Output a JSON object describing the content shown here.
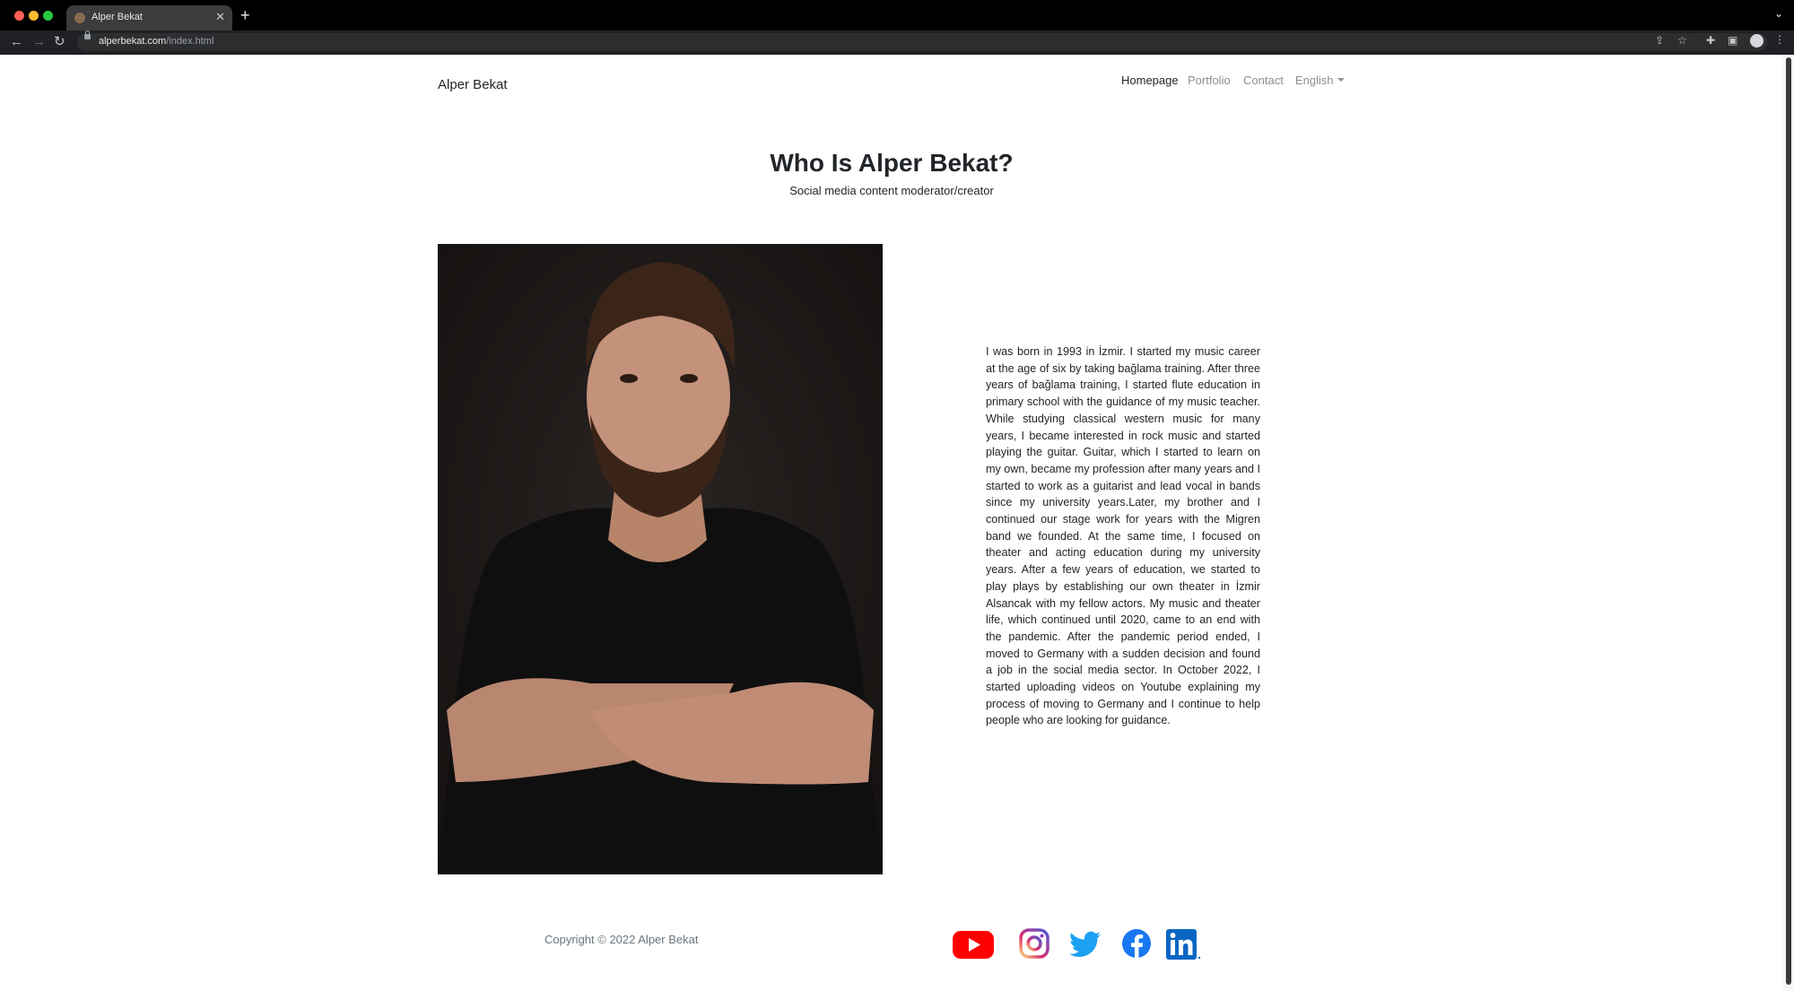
{
  "browser": {
    "tab_title": "Alper Bekat",
    "url_host": "alperbekat.com",
    "url_path": "/index.html"
  },
  "site": {
    "brand": "Alper Bekat",
    "nav": [
      {
        "label": "Homepage",
        "active": true
      },
      {
        "label": "Portfolio",
        "active": false
      },
      {
        "label": "Contact",
        "active": false
      },
      {
        "label": "English",
        "active": false
      }
    ]
  },
  "hero": {
    "title": "Who Is Alper Bekat?",
    "subtitle": "Social media content moderator/creator"
  },
  "bio": "I was born in 1993 in İzmir. I started my music career at the age of six by taking bağlama training. After three years of bağlama training, I started flute education in primary school with the guidance of my music teacher. While studying classical western music for many years, I became interested in rock music and started playing the guitar. Guitar, which I started to learn on my own, became my profession after many years and I started to work as a guitarist and lead vocal in bands since my university years.Later, my brother and I continued our stage work for years with the Migren band we founded. At the same time, I focused on theater and acting education during my university years. After a few years of education, we started to play plays by establishing our own theater in İzmir Alsancak with my fellow actors. My music and theater life, which continued until 2020, came to an end with the pandemic. After the pandemic period ended, I moved to Germany with a sudden decision and found a job in the social media sector. In October 2022, I started uploading videos on Youtube explaining my process of moving to Germany and I continue to help people who are looking for guidance.",
  "footer": {
    "copyright": "Copyright © 2022 Alper Bekat",
    "social": [
      {
        "icon": "youtube-icon",
        "color": "#ff0000"
      },
      {
        "icon": "instagram-icon",
        "color": "#e1306c"
      },
      {
        "icon": "twitter-icon",
        "color": "#1da1f2"
      },
      {
        "icon": "facebook-icon",
        "color": "#1877f2"
      },
      {
        "icon": "linkedin-icon",
        "color": "#0a66c2"
      }
    ]
  }
}
